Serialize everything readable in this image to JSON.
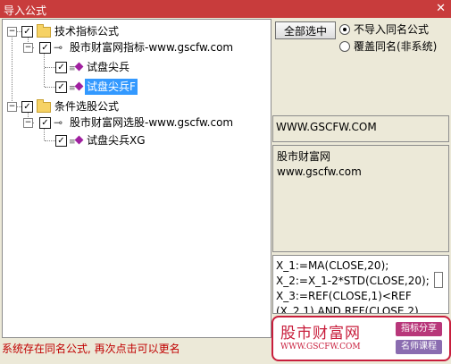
{
  "window": {
    "title": "导入公式",
    "close_glyph": "✕"
  },
  "tree": {
    "groups": [
      {
        "label": "技术指标公式",
        "checked": true,
        "provider": {
          "label": "股市财富网指标-www.gscfw.com",
          "checked": true
        },
        "items": [
          {
            "label": "试盘尖兵",
            "checked": true,
            "selected": false
          },
          {
            "label": "试盘尖兵F",
            "checked": true,
            "selected": true
          }
        ]
      },
      {
        "label": "条件选股公式",
        "checked": true,
        "provider": {
          "label": "股市财富网选股-www.gscfw.com",
          "checked": true
        },
        "items": [
          {
            "label": "试盘尖兵XG",
            "checked": true,
            "selected": false
          }
        ]
      }
    ]
  },
  "options": {
    "select_all_label": "全部选中",
    "radio_skip_label": "不导入同名公式",
    "radio_overwrite_label": "覆盖同名(非系统)",
    "selected_radio": "skip"
  },
  "info": {
    "site": "WWW.GSCFW.COM",
    "description_lines": [
      "股市财富网",
      "www.gscfw.com"
    ],
    "code_lines": [
      "X_1:=MA(CLOSE,20);",
      "X_2:=X_1-2*STD(CLOSE,20);",
      "X_3:=REF(CLOSE,1)<REF",
      "(X_2,1) AND REF(CLOSE,2)"
    ]
  },
  "status": {
    "message": "系统存在同名公式, 再次点击可以更名"
  },
  "watermark": {
    "name": "股市财富网",
    "url": "WWW.GSCFW.COM",
    "badge_top": "指标分享",
    "badge_bottom": "名师课程",
    "badge_top_color": "#b8377a",
    "badge_bottom_color": "#8a6cb0"
  }
}
